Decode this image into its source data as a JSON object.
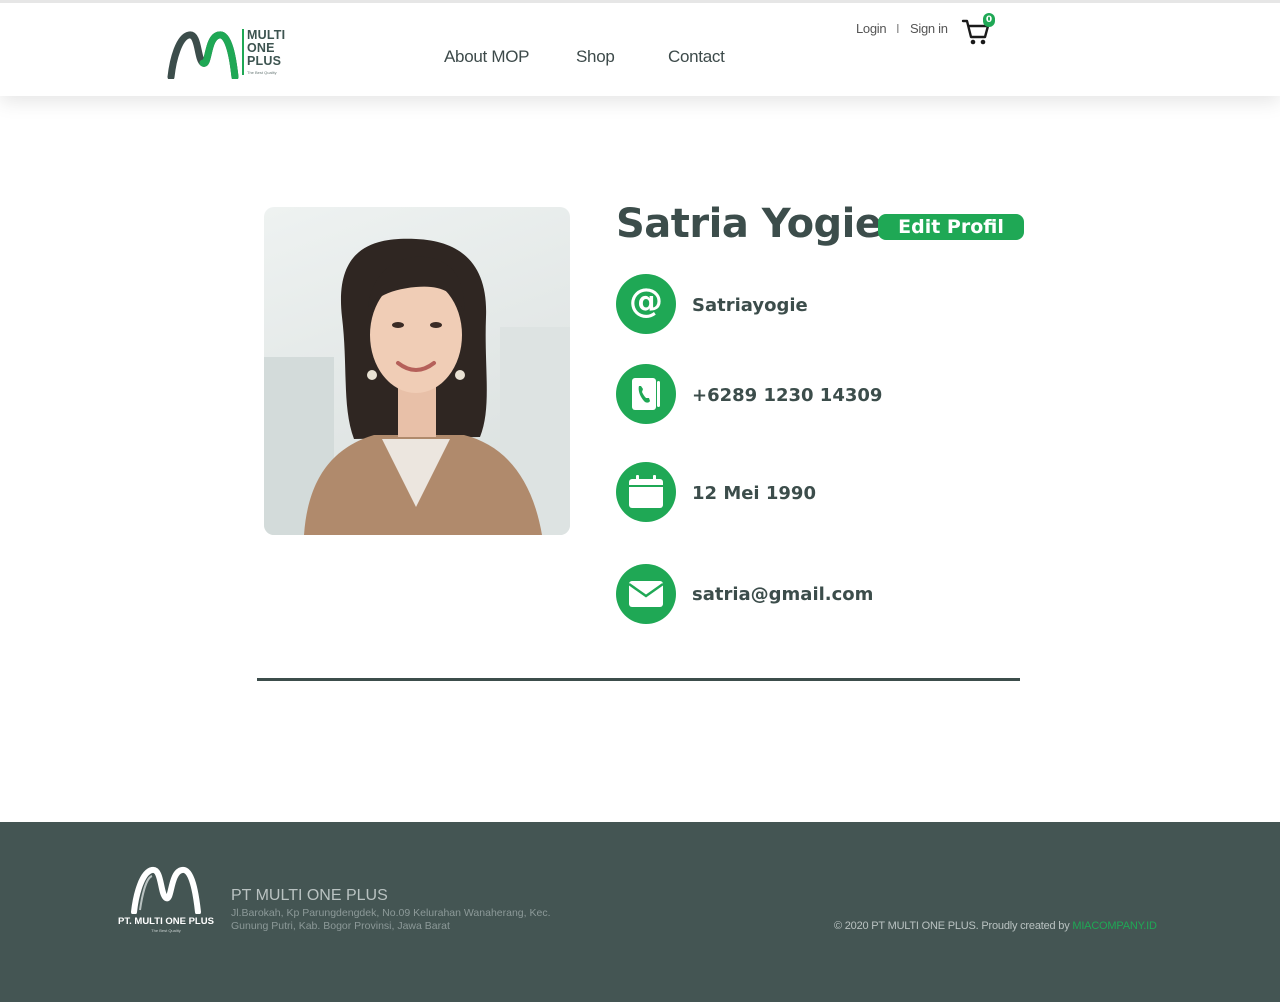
{
  "header": {
    "logo_text_lines": [
      "MULTI",
      "ONE",
      "PLUS"
    ],
    "logo_tagline": "The Best Quality",
    "nav": [
      {
        "label": "About MOP"
      },
      {
        "label": "Shop"
      },
      {
        "label": "Contact"
      }
    ],
    "auth": {
      "login": "Login",
      "separator": "I",
      "signin": "Sign in"
    },
    "cart": {
      "count": "0",
      "icon": "cart-icon"
    }
  },
  "profile": {
    "name": "Satria Yogie",
    "edit_label": "Edit Profil",
    "photo_icon": "profile-photo",
    "fields": [
      {
        "icon": "at-sign-icon",
        "value": "Satriayogie"
      },
      {
        "icon": "phone-book-icon",
        "value": "+6289 1230 14309"
      },
      {
        "icon": "calendar-icon",
        "value": "12 Mei 1990"
      },
      {
        "icon": "envelope-icon",
        "value": "satria@gmail.com"
      }
    ]
  },
  "footer": {
    "logo_name": "PT. MULTI ONE PLUS",
    "logo_tagline": "The Best Quality",
    "company": "PT MULTI ONE PLUS",
    "address": "Jl.Barokah, Kp Parungdengdek, No.09 Kelurahan Wanaherang, Kec. Gunung Putri, Kab. Bogor Provinsi, Jawa Barat",
    "copyright_prefix": "© 2020 PT MULTI ONE PLUS. Proudly created by",
    "credit_link": "MIACOMPANY.ID"
  },
  "colors": {
    "accent": "#1fa855",
    "dark": "#3c4d4b",
    "footer_bg": "#445553"
  }
}
